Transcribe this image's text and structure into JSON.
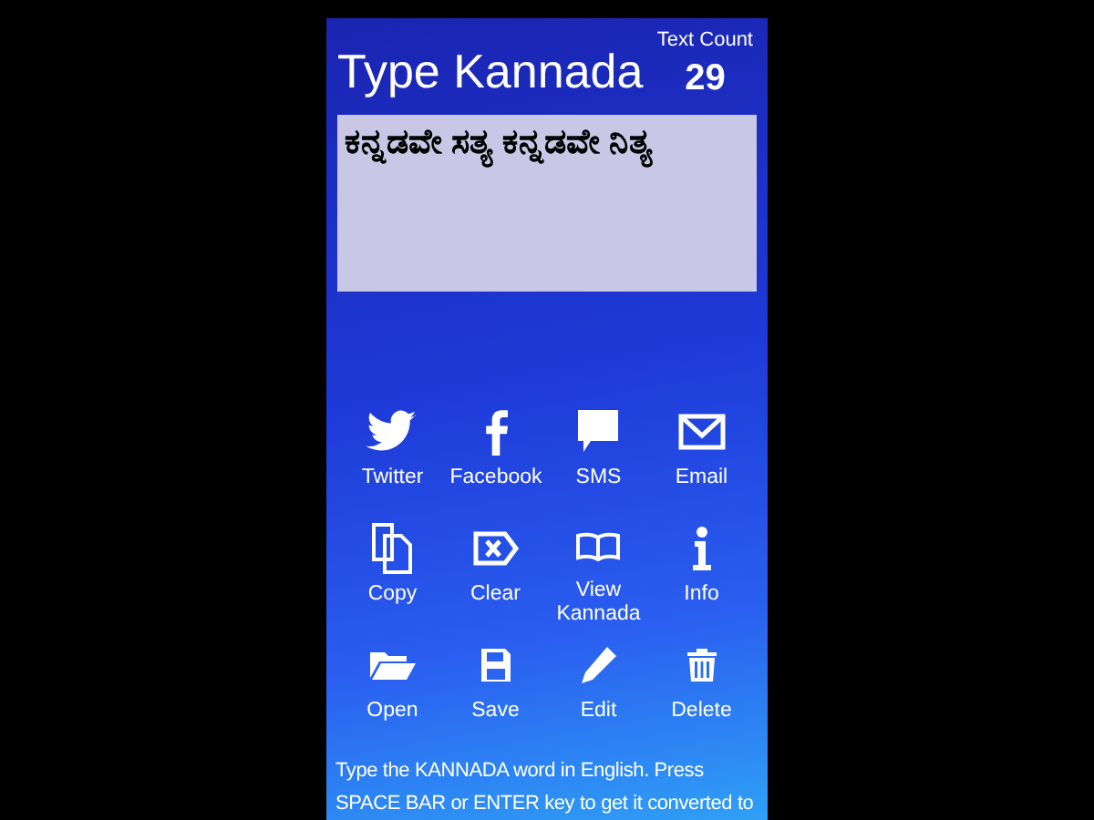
{
  "header": {
    "title": "Type Kannada",
    "count_label": "Text Count",
    "count": "29"
  },
  "editor": {
    "value": "ಕನ್ನಡವೇ ಸತ್ಯ ಕನ್ನಡವೇ ನಿತ್ಯ"
  },
  "actions": [
    {
      "kind": "twitter",
      "label": "Twitter"
    },
    {
      "kind": "facebook",
      "label": "Facebook"
    },
    {
      "kind": "sms",
      "label": "SMS"
    },
    {
      "kind": "email",
      "label": "Email"
    },
    {
      "kind": "copy",
      "label": "Copy"
    },
    {
      "kind": "clear",
      "label": "Clear"
    },
    {
      "kind": "view",
      "label": "View Kannada"
    },
    {
      "kind": "info",
      "label": "Info"
    },
    {
      "kind": "open",
      "label": "Open"
    },
    {
      "kind": "save",
      "label": "Save"
    },
    {
      "kind": "edit",
      "label": "Edit"
    },
    {
      "kind": "delete",
      "label": "Delete"
    }
  ],
  "hint": "Type the KANNADA word in English. Press SPACE BAR or ENTER key to get it converted to"
}
